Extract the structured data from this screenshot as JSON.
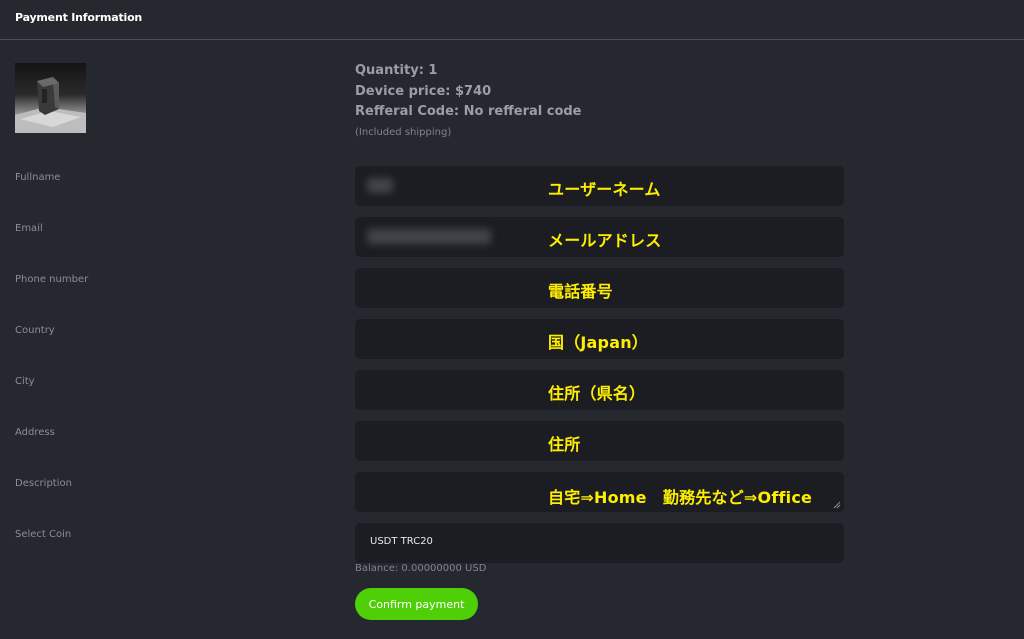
{
  "header": {
    "title": "Payment Information"
  },
  "product": {
    "image_icon": "device-photo",
    "quantity": "Quantity: 1",
    "device_price": "Device price: $740",
    "referral": "Refferal Code: No refferal code",
    "shipping_note": "(Included shipping)"
  },
  "form": {
    "fullname": {
      "label": "Fullname",
      "overlay": "ユーザーネーム"
    },
    "email": {
      "label": "Email",
      "overlay": "メールアドレス"
    },
    "phone": {
      "label": "Phone number",
      "overlay": "電話番号"
    },
    "country": {
      "label": "Country",
      "overlay": "国（Japan）"
    },
    "city": {
      "label": "City",
      "overlay": "住所（県名）"
    },
    "address": {
      "label": "Address",
      "overlay": "住所"
    },
    "description": {
      "label": "Description",
      "overlay": "自宅⇒Home　勤務先など⇒Office"
    },
    "coin": {
      "label": "Select Coin",
      "value": "USDT TRC20"
    }
  },
  "balance": "Balance: 0.00000000 USD",
  "confirm_label": "Confirm payment",
  "colors": {
    "background": "#25282f",
    "field": "#1b1d23",
    "accent": "#4fcf07",
    "overlay_text": "#ffee00"
  }
}
